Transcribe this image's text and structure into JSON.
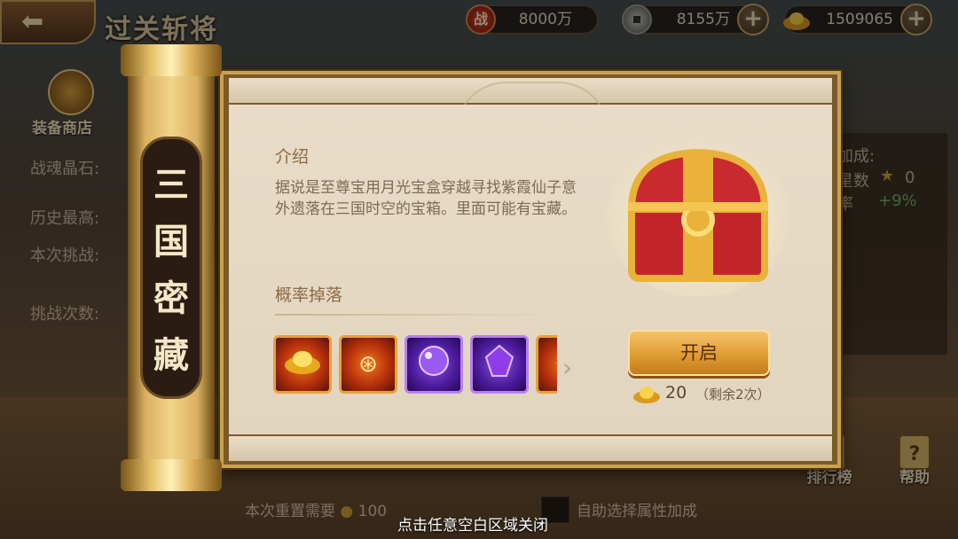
{
  "header": {
    "title": "过关斩将",
    "back_icon": "arrow-left-icon"
  },
  "resources": [
    {
      "icon": "battle-power-icon",
      "value": "8000万",
      "color": "#c0301e"
    },
    {
      "icon": "copper-coin-icon",
      "value": "8155万",
      "plus": "+"
    },
    {
      "icon": "gold-ingot-icon",
      "value": "1509065",
      "plus": "+"
    }
  ],
  "side": {
    "shop_label": "装备商店",
    "soul_crystal": "战魂晶石:",
    "history_best": "历史最高:",
    "this_challenge": "本次挑战:",
    "challenge_count": "挑战次数:"
  },
  "right_side": {
    "bonus": "加成:",
    "stars": "星数",
    "star_value": "0",
    "rate": "率",
    "rate_value": "+9%",
    "rank_label": "排行榜",
    "help_label": "帮助"
  },
  "bottom": {
    "reset_note": "本次重置需要",
    "reset_cost": "100",
    "auto_note": "自助选择属性加成",
    "close_hint": "点击任意空白区域关闭"
  },
  "modal": {
    "scroll_title": "三国密藏",
    "intro_heading": "介绍",
    "intro_text": "据说是至尊宝用月光宝盒穿越寻找紫霞仙子意外遗落在三国时空的宝箱。里面可能有宝藏。",
    "drop_heading": "概率掉落",
    "drop_items": [
      {
        "icon": "gold-ingot-icon",
        "rarity": "orange"
      },
      {
        "icon": "heaven-orb-icon",
        "rarity": "orange"
      },
      {
        "icon": "purple-orb-icon",
        "rarity": "purple"
      },
      {
        "icon": "purple-crystal-icon",
        "rarity": "purple"
      },
      {
        "icon": "fire-item-icon",
        "rarity": "orange"
      }
    ],
    "open_button": "开启",
    "cost_amount": "20",
    "remaining": "（剩余2次）"
  }
}
